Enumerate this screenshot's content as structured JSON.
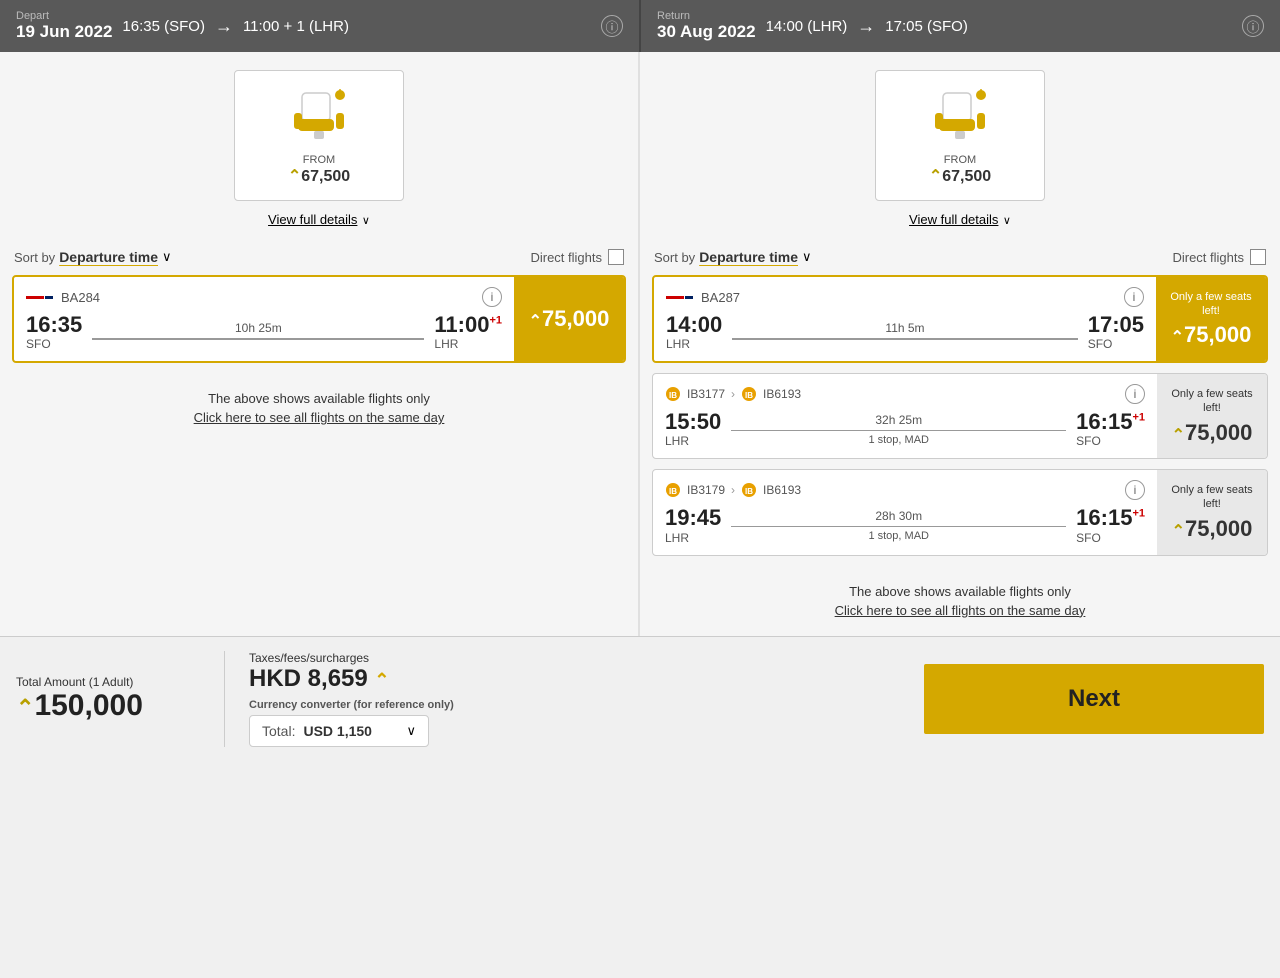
{
  "depart": {
    "label": "Depart",
    "date": "19 Jun 2022",
    "from_time": "16:35 (SFO)",
    "to_time": "11:00 + 1 (LHR)"
  },
  "return": {
    "label": "Return",
    "date": "30 Aug 2022",
    "from_time": "14:00 (LHR)",
    "to_time": "17:05 (SFO)"
  },
  "depart_seat": {
    "from_label": "FROM",
    "amount": "67,500",
    "view_details": "View full details"
  },
  "return_seat": {
    "from_label": "FROM",
    "amount": "67,500",
    "view_details": "View full details"
  },
  "depart_sort": {
    "sort_by_label": "Sort by",
    "sort_value": "Departure time",
    "direct_flights_label": "Direct flights"
  },
  "return_sort": {
    "sort_by_label": "Sort by",
    "sort_value": "Departure time",
    "direct_flights_label": "Direct flights"
  },
  "depart_flights": [
    {
      "airline": "BA284",
      "from_time": "16:35",
      "from_airport": "SFO",
      "duration": "10h 25m",
      "to_time": "11:00",
      "to_suffix": "+1",
      "to_airport": "LHR",
      "stops": "",
      "price": "75,000",
      "selected": true,
      "only_few": false
    }
  ],
  "depart_notice": {
    "line1": "The above shows available flights only",
    "line2": "Click here to see all flights on the same day"
  },
  "return_flights": [
    {
      "airline": "BA287",
      "from_time": "14:00",
      "from_airport": "LHR",
      "duration": "11h 5m",
      "to_time": "17:05",
      "to_suffix": "",
      "to_airport": "SFO",
      "stops": "",
      "price": "75,000",
      "selected": true,
      "only_few": true,
      "only_few_text": "Only a few seats left!"
    },
    {
      "airline1": "IB3177",
      "airline2": "IB6193",
      "from_time": "15:50",
      "from_airport": "LHR",
      "duration": "32h 25m",
      "stops": "1 stop, MAD",
      "to_time": "16:15",
      "to_suffix": "+1",
      "to_airport": "SFO",
      "price": "75,000",
      "selected": false,
      "only_few": true,
      "only_few_text": "Only a few seats left!"
    },
    {
      "airline1": "IB3179",
      "airline2": "IB6193",
      "from_time": "19:45",
      "from_airport": "LHR",
      "duration": "28h 30m",
      "stops": "1 stop, MAD",
      "to_time": "16:15",
      "to_suffix": "+1",
      "to_airport": "SFO",
      "price": "75,000",
      "selected": false,
      "only_few": true,
      "only_few_text": "Only a few seats left!"
    }
  ],
  "return_notice": {
    "line1": "The above shows available flights only",
    "line2": "Click here to see all flights on the same day"
  },
  "footer": {
    "total_label": "Total Amount (1 Adult)",
    "total_amount": "150,000",
    "tax_label": "Taxes/fees/surcharges",
    "tax_currency": "HKD",
    "tax_amount": "8,659",
    "currency_converter_label": "Currency converter (for reference only)",
    "currency_total_label": "Total:",
    "currency_value": "USD 1,150",
    "next_label": "Next"
  }
}
